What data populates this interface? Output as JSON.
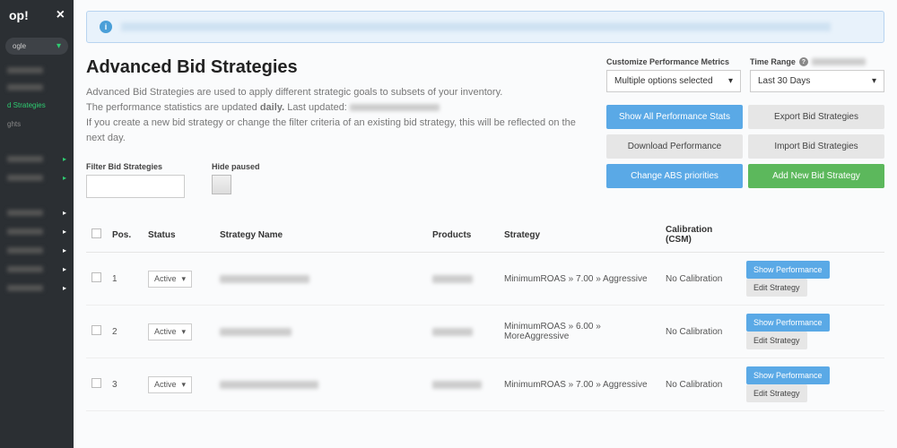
{
  "sidebar": {
    "brand_suffix": "op!",
    "account_label": "ogle",
    "nav": [
      {
        "label": "",
        "active": false
      },
      {
        "label": "d Strategies",
        "active": true
      },
      {
        "label": "ghts",
        "active": false
      }
    ]
  },
  "banner": {
    "info_glyph": "i"
  },
  "page": {
    "title": "Advanced Bid Strategies",
    "desc1": "Advanced Bid Strategies are used to apply different strategic goals to subsets of your inventory.",
    "desc2_prefix": "The performance statistics are updated ",
    "desc2_bold": "daily.",
    "desc2_last": " Last updated: ",
    "desc3": "If you create a new bid strategy or change the filter criteria of an existing bid strategy, this will be reflected on the next day."
  },
  "filters": {
    "filter_label": "Filter Bid Strategies",
    "hide_paused_label": "Hide paused"
  },
  "controls": {
    "metrics_label": "Customize Performance Metrics",
    "metrics_value": "Multiple options selected",
    "time_label": "Time Range",
    "time_value": "Last 30 Days",
    "buttons": {
      "show_stats": "Show All Performance Stats",
      "export": "Export Bid Strategies",
      "download": "Download Performance",
      "import": "Import Bid Strategies",
      "priorities": "Change ABS priorities",
      "add_new": "Add New Bid Strategy"
    }
  },
  "table": {
    "headers": {
      "pos": "Pos.",
      "status": "Status",
      "name": "Strategy Name",
      "products": "Products",
      "strategy": "Strategy",
      "calibration": "Calibration (CSM)"
    },
    "status_option": "Active",
    "btn_show": "Show Performance",
    "btn_edit": "Edit Strategy",
    "rows": [
      {
        "pos": "1",
        "strategy": "MinimumROAS » 7.00 » Aggressive",
        "calibration": "No Calibration"
      },
      {
        "pos": "2",
        "strategy": "MinimumROAS » 6.00 » MoreAggressive",
        "calibration": "No Calibration"
      },
      {
        "pos": "3",
        "strategy": "MinimumROAS » 7.00 » Aggressive",
        "calibration": "No Calibration"
      }
    ]
  }
}
